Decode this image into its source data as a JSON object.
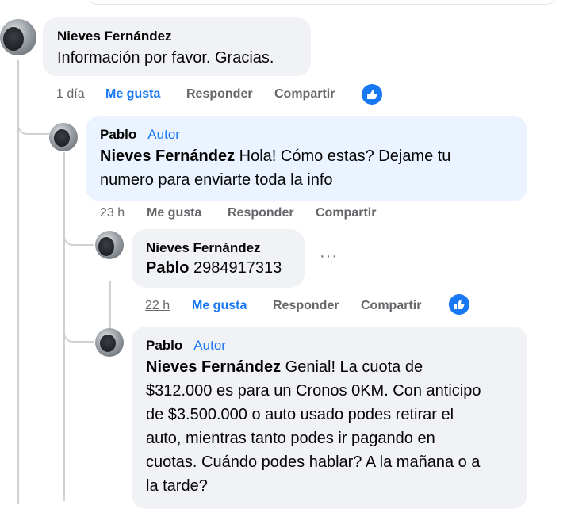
{
  "thread": {
    "comment1": {
      "author": "Nieves Fernández",
      "text": "Información por favor. Gracias.",
      "time": "1 día",
      "like": "Me gusta",
      "reply": "Responder",
      "share": "Compartir"
    },
    "reply1": {
      "author": "Pablo",
      "badge": "Autor",
      "mention": "Nieves Fernández",
      "text_line1": " Hola! Cómo estas? Dejame tu",
      "text_line2": "numero para enviarte toda la info",
      "time": "23 h",
      "like": "Me gusta",
      "reply": "Responder",
      "share": "Compartir"
    },
    "reply2": {
      "author": "Nieves Fernández",
      "mention": "Pablo",
      "text": " 2984917313",
      "more": "···",
      "time": "22 h",
      "like": "Me gusta",
      "reply": "Responder",
      "share": "Compartir"
    },
    "reply3": {
      "author": "Pablo",
      "badge": "Autor",
      "mention": "Nieves Fernández",
      "line1": " Genial! La cuota de",
      "line2": "$312.000 es para un Cronos 0KM. Con anticipo",
      "line3": "de $3.500.000 o auto usado podes retirar el",
      "line4": "auto, mientras tanto podes ir pagando en",
      "line5": "cuotas. Cuándo podes hablar? A la mañana o a",
      "line6": "la tarde?"
    }
  },
  "colors": {
    "accent": "#1877f2",
    "bubble": "#f0f2f5",
    "author_bubble": "#eaf3ff",
    "secondary_text": "#65676b"
  },
  "icons": {
    "reaction": "thumbs-up-icon",
    "more": "more-options-icon"
  }
}
